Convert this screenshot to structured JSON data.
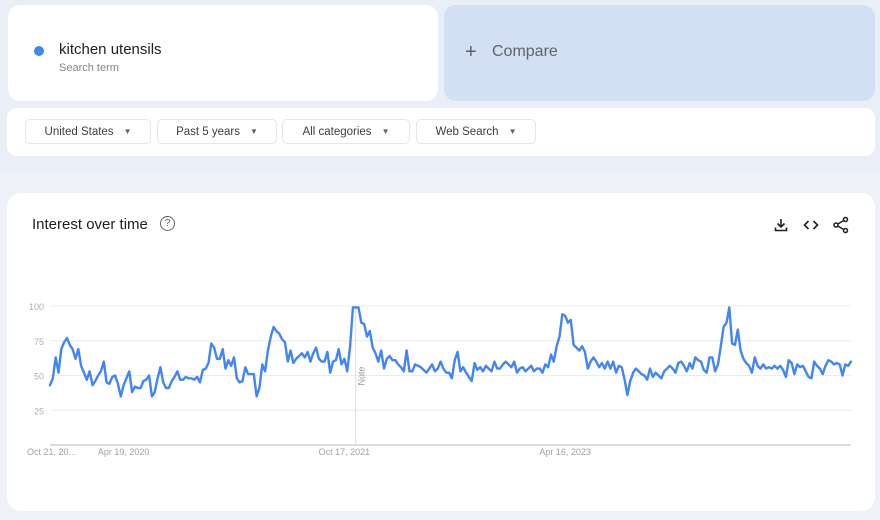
{
  "search_term": {
    "label": "kitchen utensils",
    "sublabel": "Search term",
    "color": "#4285f4"
  },
  "compare": {
    "icon": "plus-icon",
    "label": "Compare"
  },
  "filters": [
    {
      "label": "United States",
      "icon": "caret-down-icon"
    },
    {
      "label": "Past 5 years",
      "icon": "caret-down-icon"
    },
    {
      "label": "All categories",
      "icon": "caret-down-icon"
    },
    {
      "label": "Web Search",
      "icon": "caret-down-icon"
    }
  ],
  "panel": {
    "title": "Interest over time",
    "help_icon": "?",
    "actions": [
      "download-icon",
      "embed-code-icon",
      "share-icon"
    ]
  },
  "chart_data": {
    "type": "line",
    "title": "Interest over time",
    "xlabel": "",
    "ylabel": "",
    "ylim": [
      0,
      100
    ],
    "yticks": [
      25,
      50,
      75,
      100
    ],
    "xtick_labels": [
      "Oct 21, 20...",
      "Apr 19, 2020",
      "Oct 17, 2021",
      "Apr 16, 2023"
    ],
    "xtick_index": [
      0,
      26,
      104,
      182
    ],
    "grid": true,
    "legend": "none",
    "annotation": {
      "label": "Note",
      "index": 108
    },
    "series": [
      {
        "name": "kitchen utensils",
        "color": "#4285f4",
        "values": [
          43,
          48,
          63,
          52,
          69,
          74,
          77,
          72,
          69,
          62,
          69,
          57,
          52,
          47,
          53,
          43,
          46,
          50,
          53,
          60,
          45,
          44,
          49,
          50,
          44,
          35,
          43,
          48,
          53,
          38,
          42,
          41,
          41,
          46,
          47,
          50,
          35,
          38,
          48,
          56,
          45,
          41,
          41,
          46,
          49,
          53,
          47,
          47,
          49,
          48,
          48,
          47,
          49,
          45,
          54,
          55,
          59,
          73,
          70,
          62,
          62,
          69,
          55,
          61,
          57,
          63,
          48,
          45,
          46,
          56,
          51,
          51,
          51,
          35,
          41,
          58,
          53,
          68,
          78,
          85,
          82,
          80,
          76,
          74,
          60,
          68,
          59,
          62,
          64,
          66,
          63,
          67,
          60,
          66,
          70,
          62,
          60,
          60,
          67,
          52,
          60,
          61,
          69,
          58,
          62,
          53,
          70,
          99,
          99,
          99,
          88,
          87,
          78,
          82,
          70,
          66,
          60,
          68,
          55,
          62,
          64,
          61,
          61,
          58,
          56,
          53,
          68,
          53,
          53,
          58,
          57,
          56,
          54,
          52,
          55,
          58,
          53,
          55,
          60,
          55,
          52,
          52,
          48,
          61,
          67,
          53,
          56,
          52,
          49,
          46,
          59,
          54,
          56,
          53,
          57,
          55,
          53,
          60,
          55,
          55,
          58,
          60,
          58,
          56,
          60,
          52,
          55,
          56,
          53,
          55,
          57,
          53,
          55,
          55,
          52,
          58,
          56,
          65,
          60,
          71,
          78,
          94,
          93,
          88,
          90,
          72,
          70,
          68,
          71,
          67,
          55,
          60,
          63,
          60,
          56,
          59,
          55,
          60,
          55,
          60,
          52,
          57,
          56,
          47,
          36,
          46,
          52,
          55,
          53,
          51,
          50,
          47,
          55,
          49,
          52,
          50,
          48,
          53,
          55,
          57,
          55,
          52,
          59,
          60,
          57,
          53,
          59,
          55,
          63,
          61,
          60,
          54,
          52,
          63,
          63,
          53,
          58,
          71,
          85,
          88,
          99,
          73,
          72,
          83,
          68,
          62,
          59,
          57,
          52,
          63,
          57,
          55,
          58,
          55,
          56,
          55,
          57,
          55,
          57,
          54,
          49,
          61,
          59,
          51,
          58,
          56,
          57,
          53,
          49,
          48,
          60,
          57,
          55,
          51,
          57,
          61,
          60,
          58,
          59,
          58,
          50,
          58,
          57,
          60
        ]
      }
    ]
  }
}
